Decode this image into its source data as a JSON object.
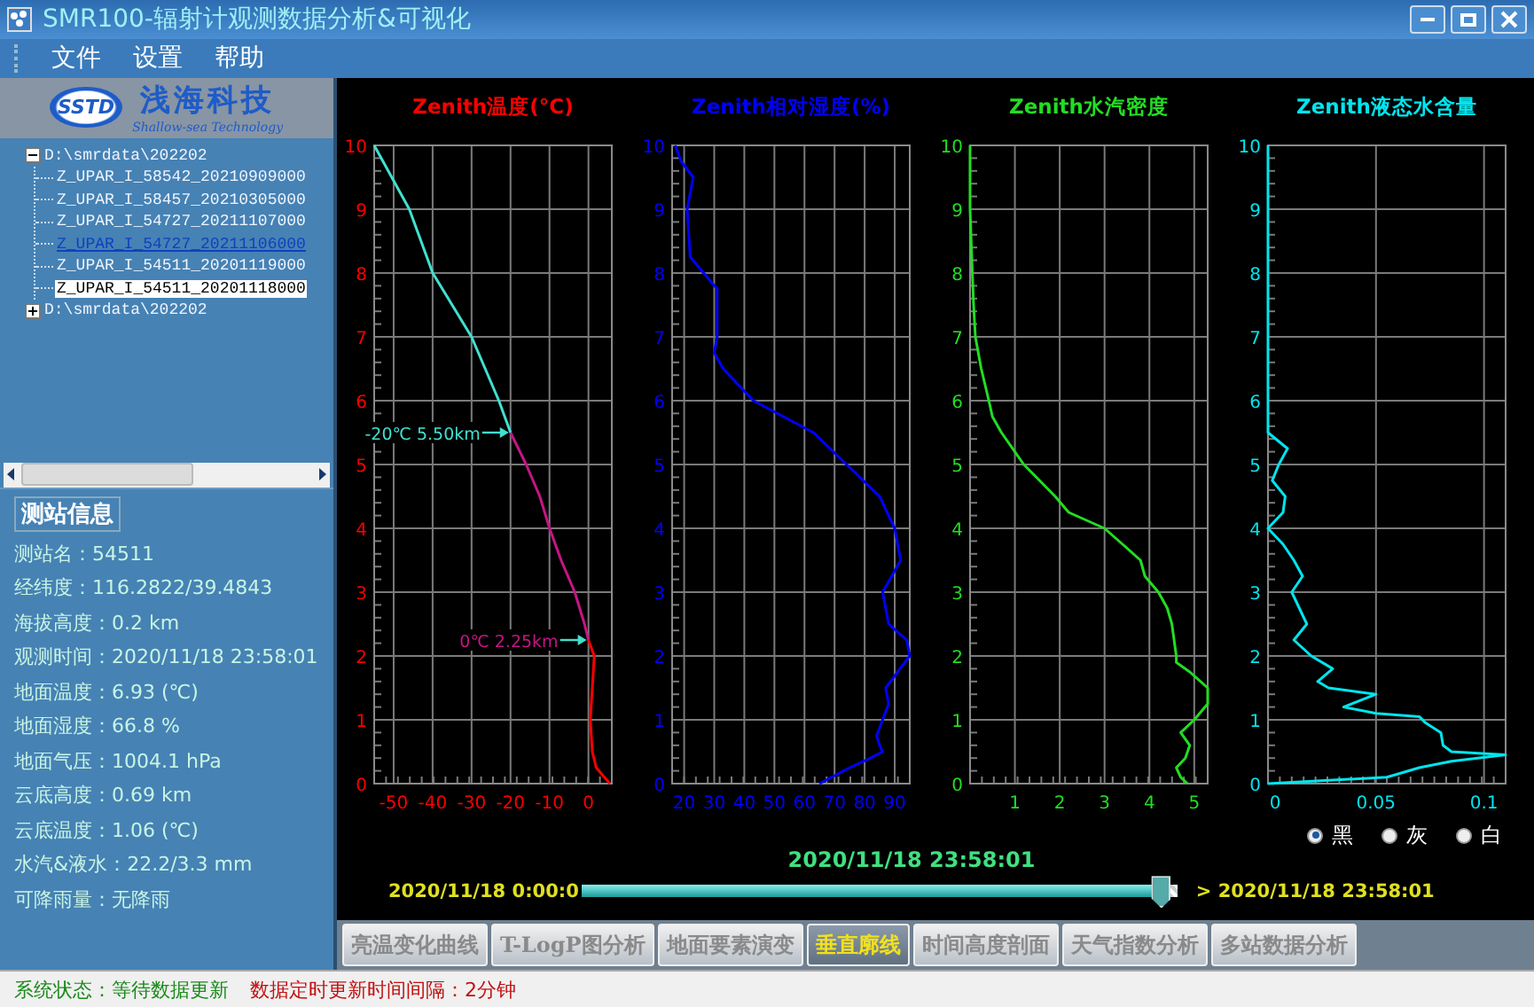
{
  "window": {
    "title": "SMR100-辐射计观测数据分析&可视化"
  },
  "menu": [
    "文件",
    "设置",
    "帮助"
  ],
  "logo": {
    "mark": "SSTD",
    "name": "浅海科技",
    "tagline": "Shallow-sea Technology"
  },
  "tree": [
    {
      "label": "D:\\smrdata\\202202",
      "expanded": true,
      "selected": false,
      "hovered": false,
      "children": [
        {
          "label": "Z_UPAR_I_58542_20210909000",
          "selected": false,
          "hovered": false
        },
        {
          "label": "Z_UPAR_I_58457_20210305000",
          "selected": false,
          "hovered": false
        },
        {
          "label": "Z_UPAR_I_54727_20211107000",
          "selected": false,
          "hovered": false
        },
        {
          "label": "Z_UPAR_I_54727_20211106000",
          "selected": false,
          "hovered": true
        },
        {
          "label": "Z_UPAR_I_54511_20201119000",
          "selected": false,
          "hovered": false
        },
        {
          "label": "Z_UPAR_I_54511_20201118000",
          "selected": true,
          "hovered": false
        }
      ]
    },
    {
      "label": "D:\\smrdata\\202202",
      "expanded": false,
      "selected": false,
      "hovered": false
    }
  ],
  "station_info": {
    "title": "测站信息",
    "lines": [
      "测站名：54511",
      "经纬度：116.2822/39.4843",
      "海拔高度：0.2 km",
      "观测时间：2020/11/18 23:58:01",
      "地面温度：6.93 (℃)",
      "地面湿度：66.8 %",
      "地面气压：1004.1 hPa",
      "云底高度：0.69 km",
      "云底温度：1.06 (℃)",
      "水汽&液水：22.2/3.3 mm",
      "可降雨量：无降雨"
    ]
  },
  "charts": [
    {
      "chart_data": {
        "type": "line",
        "title": "Zenith温度(°C)",
        "orientation": "horizontal",
        "x": [
          0,
          0.25,
          0.5,
          1,
          1.5,
          2,
          2.25,
          2.5,
          3,
          3.5,
          4,
          4.5,
          5,
          5.5,
          6,
          7,
          8,
          9,
          10
        ],
        "series": [
          {
            "color": "#ff0000",
            "values": [
              5.5,
              2,
              1,
              0.5,
              1,
              1.5,
              0,
              null,
              null,
              null,
              null,
              null,
              null,
              null,
              null,
              null,
              null,
              null,
              null
            ]
          },
          {
            "color": "#c71585",
            "values": [
              null,
              null,
              null,
              null,
              null,
              null,
              0,
              -1,
              -3.5,
              -7,
              -10,
              -12.5,
              -16,
              -20,
              null,
              null,
              null,
              null,
              null
            ]
          },
          {
            "color": "#40e0d0",
            "values": [
              null,
              null,
              null,
              null,
              null,
              null,
              null,
              null,
              null,
              null,
              null,
              null,
              null,
              -20,
              -23,
              -30,
              -40,
              -46,
              -55
            ]
          }
        ],
        "xlim": [
          -55,
          6
        ],
        "ylim": [
          0,
          10
        ],
        "xticks": [
          -50,
          -40,
          -30,
          -20,
          -10,
          0
        ],
        "yticks": [
          0,
          1,
          2,
          3,
          4,
          5,
          6,
          7,
          8,
          9,
          10
        ],
        "grid": true,
        "annotations": [
          {
            "text": "-20℃ 5.50km",
            "x": -20,
            "y": 5.5
          },
          {
            "text": "0℃ 2.25km",
            "x": 0,
            "y": 2.25
          }
        ]
      }
    },
    {
      "chart_data": {
        "type": "line",
        "title": "Zenith相对湿度(%)",
        "orientation": "horizontal",
        "x": [
          0,
          0.25,
          0.4,
          0.5,
          0.6,
          0.75,
          1,
          1.25,
          1.5,
          2,
          2.25,
          2.5,
          3,
          3.5,
          4,
          4.5,
          5,
          5.5,
          6,
          6.5,
          6.75,
          7,
          7.75,
          8.25,
          9,
          9.5,
          9.75,
          10
        ],
        "series": [
          {
            "color": "#0000ff",
            "values": [
              65,
              75,
              82,
              86,
              85,
              84,
              86,
              88,
              87,
              95,
              94,
              88,
              86,
              92,
              90,
              85,
              74,
              63,
              43,
              33,
              30,
              31,
              31,
              22,
              21,
              23,
              19,
              17
            ]
          }
        ],
        "xlim": [
          16,
          95
        ],
        "grid": true,
        "ylim": [
          0,
          10
        ],
        "xticks": [
          20,
          30,
          40,
          50,
          60,
          70,
          80,
          90
        ],
        "yticks": [
          0,
          1,
          2,
          3,
          4,
          5,
          6,
          7,
          8,
          9,
          10
        ]
      }
    },
    {
      "chart_data": {
        "type": "line",
        "title": "Zenith水汽密度",
        "orientation": "horizontal",
        "x": [
          0,
          0.1,
          0.25,
          0.4,
          0.6,
          0.8,
          1,
          1.25,
          1.5,
          1.75,
          1.9,
          2,
          2.5,
          2.75,
          3,
          3.25,
          3.5,
          3.75,
          4,
          4.25,
          4.5,
          5,
          5.5,
          5.75,
          6,
          6.5,
          7,
          7.5,
          8,
          9,
          10
        ],
        "series": [
          {
            "color": "#22dd22",
            "values": [
              4.85,
              4.7,
              4.6,
              4.8,
              4.9,
              4.7,
              5,
              5.3,
              5.3,
              4.9,
              4.6,
              4.6,
              4.5,
              4.4,
              4.2,
              3.9,
              3.8,
              3.4,
              3,
              2.2,
              1.9,
              1.2,
              0.7,
              0.5,
              0.42,
              0.25,
              0.12,
              0.08,
              0.05,
              0,
              0
            ],
            "name": null
          }
        ],
        "xlim": [
          0,
          5.3
        ],
        "grid": true,
        "ylim": [
          0,
          10
        ],
        "xticks": [
          1,
          2,
          3,
          4,
          5
        ],
        "yticks": [
          0,
          1,
          2,
          3,
          4,
          5,
          6,
          7,
          8,
          9,
          10
        ]
      }
    },
    {
      "chart_data": {
        "type": "line",
        "title": "Zenith液态水含量",
        "orientation": "horizontal",
        "x": [
          0,
          0.1,
          0.15,
          0.25,
          0.35,
          0.45,
          0.5,
          0.6,
          0.8,
          0.95,
          1.05,
          1.1,
          1.2,
          1.4,
          1.5,
          1.6,
          1.8,
          2,
          2.25,
          2.5,
          3,
          3.25,
          3.5,
          3.75,
          4,
          4.25,
          4.5,
          4.75,
          5,
          5.25,
          5.5,
          10
        ],
        "series": [
          {
            "color": "#00e5ee",
            "values": [
              0,
              0.055,
              0.06,
              0.07,
              0.085,
              0.11,
              0.085,
              0.081,
              0.08,
              0.073,
              0.07,
              0.05,
              0.035,
              0.05,
              0.028,
              0.023,
              0.03,
              0.02,
              0.012,
              0.018,
              0.011,
              0.016,
              0.012,
              0.007,
              0,
              0.007,
              0.008,
              0.002,
              0.005,
              0.009,
              0,
              0
            ]
          }
        ],
        "xlim": [
          0,
          0.11
        ],
        "grid": true,
        "ylim": [
          0,
          10
        ],
        "xticks": [
          0,
          0.05,
          0.1
        ],
        "yticks": [
          0,
          1,
          2,
          3,
          4,
          5,
          6,
          7,
          8,
          9,
          10
        ]
      }
    }
  ],
  "theme_options": [
    {
      "label": "黑",
      "selected": true
    },
    {
      "label": "灰",
      "selected": false
    },
    {
      "label": "白",
      "selected": false
    }
  ],
  "time_slider": {
    "current": "2020/11/18 23:58:01",
    "start": "2020/11/18 0:00:0",
    "end": "> 2020/11/18 23:58:01",
    "level": 0.99
  },
  "tabs": [
    {
      "label": "亮温变化曲线",
      "selected": false
    },
    {
      "label": "T-LogP图分析",
      "selected": false
    },
    {
      "label": "地面要素演变",
      "selected": false
    },
    {
      "label": "垂直廓线",
      "selected": true
    },
    {
      "label": "时间高度剖面",
      "selected": false
    },
    {
      "label": "天气指数分析",
      "selected": false
    },
    {
      "label": "多站数据分析",
      "selected": false
    }
  ],
  "status_bar": [
    {
      "kind": "state",
      "text": "系统状态：等待数据更新"
    },
    {
      "kind": "interval",
      "text": "数据定时更新时间间隔：2分钟"
    }
  ]
}
